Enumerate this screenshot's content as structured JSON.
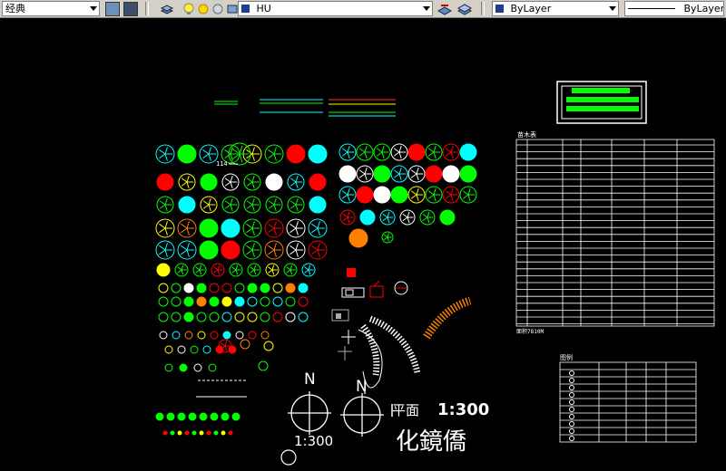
{
  "toolbar": {
    "workspace_combo": "经典",
    "layer_combo": "HU",
    "color_combo": "ByLayer",
    "linetype_combo": "ByLayer"
  },
  "drawing": {
    "scale_label_1": "1:300",
    "plan_label": "平面",
    "plan_scale": "1:300",
    "north_1": "N",
    "north_2": "N",
    "title_chars": "化鏡僑",
    "table_title": "苗木表",
    "table_footer": "面积7810M",
    "legend_title": "图例",
    "tag_label": "114"
  },
  "colors": {
    "toolbar_bg": "#d4d0c8",
    "canvas_bg": "#000000",
    "green": "#00ff00",
    "cyan": "#00ffff",
    "yellow": "#ffff00",
    "red": "#ff0000",
    "orange": "#ff8000",
    "white": "#ffffff"
  }
}
